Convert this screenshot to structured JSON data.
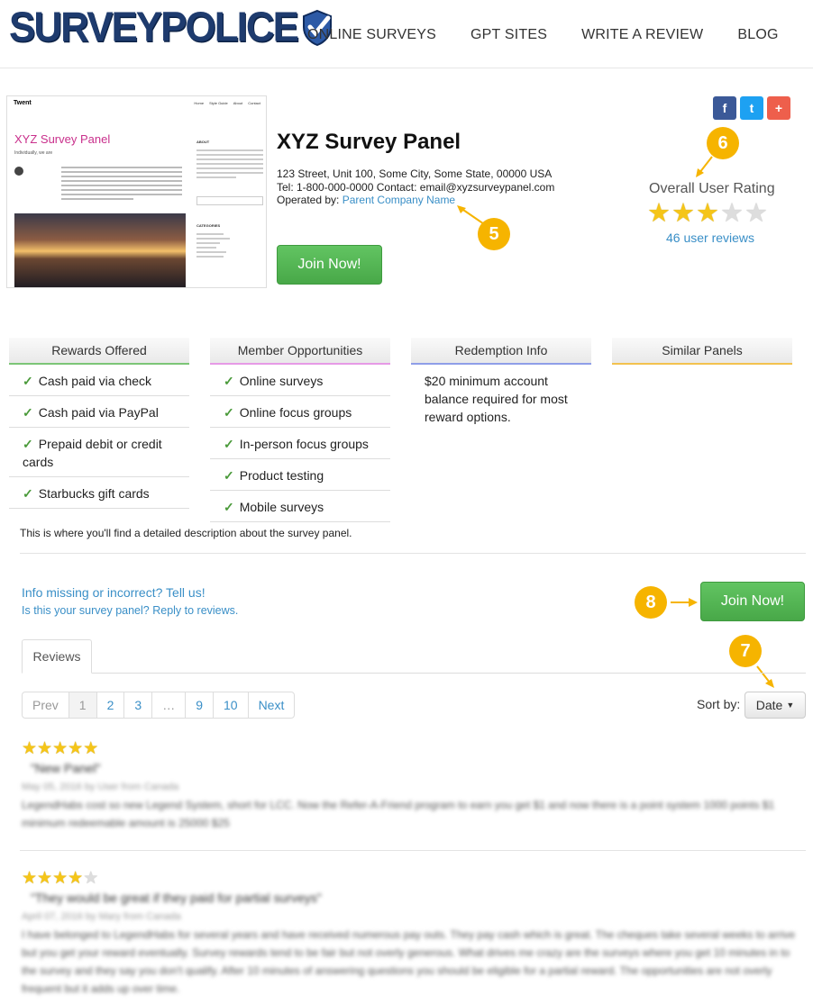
{
  "header": {
    "logo": "SURVEYPOLICE",
    "nav": [
      "ONLINE SURVEYS",
      "GPT SITES",
      "WRITE A REVIEW",
      "BLOG"
    ]
  },
  "thumbnail": {
    "site_title": "Twent",
    "nav_items": [
      "Home",
      "Style Guide",
      "About",
      "Contact"
    ],
    "heading": "XYZ Survey Panel",
    "subheading": "Individually, we are",
    "side_about": "ABOUT",
    "side_categories": "CATEGORIES"
  },
  "panel": {
    "title": "XYZ Survey Panel",
    "address_line": "123 Street, Unit 100, Some City, Some State, 00000 USA",
    "contact_line": "Tel: 1-800-000-0000 Contact: email@xyzsurveypanel.com",
    "operated_label": "Operated by:",
    "operator_link": "Parent Company Name",
    "join_label": "Join Now!"
  },
  "social": {
    "facebook": "f",
    "twitter": "t",
    "plus": "+"
  },
  "rating": {
    "label": "Overall User Rating",
    "stars": 3,
    "max_stars": 5,
    "reviews_link": "46 user reviews"
  },
  "callouts": {
    "c5": "5",
    "c6": "6",
    "c7": "7",
    "c8": "8"
  },
  "boxes": {
    "rewards": {
      "title": "Rewards Offered",
      "color": "#7cc576",
      "items": [
        "Cash paid via check",
        "Cash paid via PayPal",
        "Prepaid debit or credit cards",
        "Starbucks gift cards"
      ]
    },
    "opportunities": {
      "title": "Member Opportunities",
      "color": "#e69ae6",
      "items": [
        "Online surveys",
        "Online focus groups",
        "In-person focus groups",
        "Product testing",
        "Mobile surveys"
      ]
    },
    "redemption": {
      "title": "Redemption Info",
      "color": "#8f9ee8",
      "text": "$20 minimum account balance required for most reward options."
    },
    "similar": {
      "title": "Similar Panels",
      "color": "#f2c14e"
    }
  },
  "description": "This is where you'll find a detailed description about the survey panel.",
  "info": {
    "missing_link": "Info missing or incorrect? Tell us!",
    "owner_link": "Is this your survey panel? Reply to reviews.",
    "join_label": "Join Now!"
  },
  "tabs": {
    "reviews": "Reviews"
  },
  "pagination": [
    "Prev",
    "1",
    "2",
    "3",
    "…",
    "9",
    "10",
    "Next"
  ],
  "sort": {
    "label": "Sort by:",
    "value": "Date"
  },
  "reviews": [
    {
      "stars": 5,
      "title": "\"New Panel\"",
      "meta": "May 05, 2016 by User from Canada",
      "body": "LegendHabs cost so new Legend System, short for LCC. Now the Refer-A-Friend program to earn you get $1 and now there is a point system 1000 points $1 minimum redeemable amount is 25000 $25"
    },
    {
      "stars": 4,
      "title": "\"They would be great if they paid for partial surveys\"",
      "meta": "April 07, 2016 by Mary from Canada",
      "body": "I have belonged to LegendHabs for several years and have received numerous pay outs. They pay cash which is great. The cheques take several weeks to arrive but you get your reward eventually. Survey rewards tend to be fair but not overly generous. What drives me crazy are the surveys where you get 10 minutes in to the survey and they say you don't qualify. After 10 minutes of answering questions you should be eligible for a partial reward. The opportunities are not overly frequent but it adds up over time."
    }
  ]
}
